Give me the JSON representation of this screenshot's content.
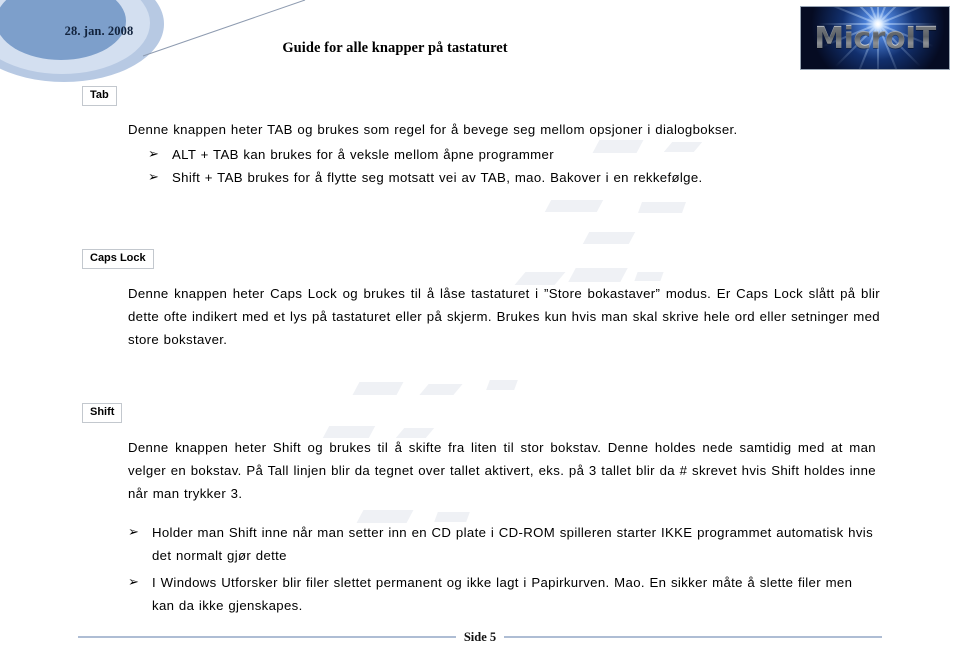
{
  "header": {
    "date": "28. jan. 2008",
    "title": "Guide for alle knapper på tastaturet",
    "logo_text": "MicroIT",
    "logo_bg_color": "#0b1230",
    "circle_outer_color": "#b7c9e3",
    "circle_mid_color": "#d3dff0",
    "circle_inner_color": "#7d9fcb"
  },
  "sections": [
    {
      "key_label": "Tab",
      "paragraph": "Denne knappen heter TAB og brukes som regel for å bevege seg mellom opsjoner i dialogbokser.",
      "bullets": [
        "ALT + TAB kan brukes for å veksle mellom åpne programmer",
        "Shift + TAB brukes for å flytte seg motsatt vei av TAB, mao. Bakover i en rekkefølge."
      ]
    },
    {
      "key_label": "Caps Lock",
      "paragraph": "Denne knappen heter Caps Lock og brukes til å låse tastaturet i ”Store bokastaver” modus. Er Caps Lock slått på blir dette ofte indikert med et lys på tastaturet eller på skjerm. Brukes kun hvis man skal skrive hele ord eller setninger med store bokstaver.",
      "bullets": []
    },
    {
      "key_label": "Shift",
      "paragraph": "Denne knappen heter Shift og brukes til å skifte fra liten til stor bokstav. Denne holdes nede samtidig med at man velger en bokstav. På Tall linjen blir da tegnet over tallet aktivert, eks. på 3 tallet blir da # skrevet hvis Shift holdes inne når man trykker 3.",
      "bullets": [
        "Holder man Shift inne når man setter inn en CD plate i CD-ROM spilleren starter IKKE programmet automatisk hvis det normalt gjør dette",
        "I Windows Utforsker blir filer slettet permanent og ikke lagt i Papirkurven. Mao. En sikker måte å slette filer men kan da ikke gjenskapes."
      ]
    }
  ],
  "bullet_glyph": "➢",
  "footer": {
    "page_label": "Side 5",
    "rule_color": "#aebdd4"
  }
}
